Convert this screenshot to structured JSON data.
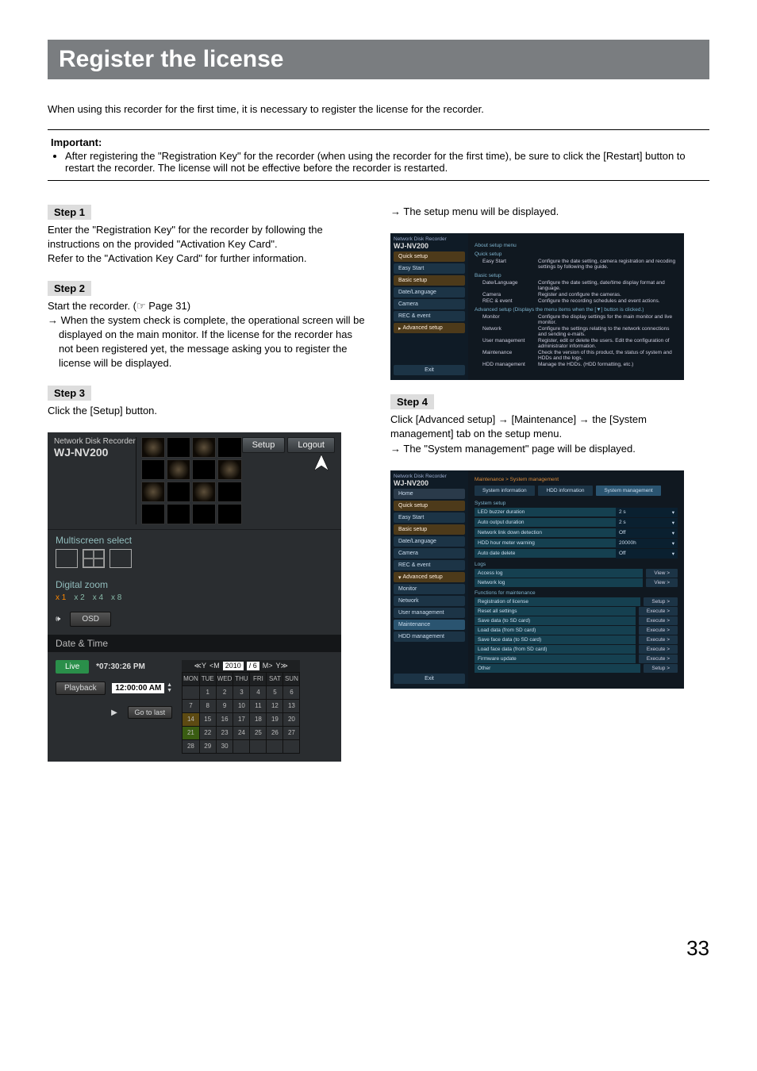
{
  "page": {
    "title": "Register the license",
    "intro": "When using this recorder for the first time, it is necessary to register the license for the recorder.",
    "important_hdr": "Important:",
    "important_bullet": "After registering the \"Registration Key\" for the recorder (when using the recorder for the first time), be sure to click the [Restart] button to restart the recorder. The license will not be effective before the recorder is restarted.",
    "page_number": "33"
  },
  "steps": {
    "s1": {
      "label": "Step 1",
      "body1": "Enter the \"Registration Key\" for the recorder by following the instructions on the provided \"Activation Key Card\".",
      "body2": "Refer to the \"Activation Key Card\" for further information."
    },
    "s2": {
      "label": "Step 2",
      "body1": "Start the recorder. (☞ Page 31)",
      "arrow": "→ When the system check is complete, the operational screen will be displayed on the main monitor. If the license for the recorder has not been registered yet, the message asking you to register the license will be displayed."
    },
    "s3": {
      "label": "Step 3",
      "body1": "Click the [Setup] button.",
      "top_arrow": "→ The setup menu will be displayed."
    },
    "s4": {
      "label": "Step 4",
      "body1": "Click [Advanced setup] → [Maintenance] → the [System management] tab on the setup menu.",
      "arrow": "→ The \"System management\" page will be displayed."
    }
  },
  "shot1": {
    "model_lbl": "Network Disk Recorder",
    "model": "WJ-NV200",
    "btn_setup": "Setup",
    "btn_logout": "Logout",
    "multiscreen": "Multiscreen select",
    "digital_zoom": "Digital zoom",
    "zooms": [
      "x 1",
      "x 2",
      "x 4",
      "x 8"
    ],
    "osd": "OSD",
    "date_time": "Date & Time",
    "live": "Live",
    "live_time": "*07:30:26 PM",
    "playback": "Playback",
    "playback_time": "12:00:00 AM",
    "go_to_last": "Go to last",
    "cal_year": "2010",
    "cal_month_day": "/  6",
    "days": [
      "MON",
      "TUE",
      "WED",
      "THU",
      "FRI",
      "SAT",
      "SUN"
    ],
    "cal": [
      [
        "",
        "1",
        "2",
        "3",
        "4",
        "5",
        "6"
      ],
      [
        "7",
        "8",
        "9",
        "10",
        "11",
        "12",
        "13"
      ],
      [
        "14",
        "15",
        "16",
        "17",
        "18",
        "19",
        "20"
      ],
      [
        "21",
        "22",
        "23",
        "24",
        "25",
        "26",
        "27"
      ],
      [
        "28",
        "29",
        "30",
        "",
        "",
        "",
        ""
      ]
    ]
  },
  "shot2": {
    "model_lbl": "Network Disk Recorder",
    "model": "WJ-NV200",
    "side": {
      "quick_setup": "Quick setup",
      "easy_start": "Easy Start",
      "basic_setup": "Basic setup",
      "date_language": "Date/Language",
      "camera": "Camera",
      "rec_event": "REC & event",
      "advanced_setup": "Advanced setup",
      "exit": "Exit"
    },
    "main": {
      "about": "About setup menu",
      "quick_setup": "Quick setup",
      "easy_start": "Easy Start",
      "easy_start_desc": "Configure the date setting, camera registration and recoding settings by following the guide.",
      "basic_setup": "Basic setup",
      "date_lang": "Date/Language",
      "date_lang_desc": "Configure the date setting, date/time display format and language.",
      "camera": "Camera",
      "camera_desc": "Register and configure the cameras.",
      "rec_event": "REC & event",
      "rec_event_desc": "Configure the recording schedules and event actions.",
      "adv": "Advanced setup (Displays the menu items when the [▼] button is clicked.)",
      "monitor": "Monitor",
      "monitor_desc": "Configure the display settings for the main monitor and live monitor.",
      "network": "Network",
      "network_desc": "Configure the settings relating to the network connections and sending e-mails.",
      "user_mgmt": "User management",
      "user_mgmt_desc": "Register, edit or delete the users. Edit the configuration of administrator information.",
      "maint": "Maintenance",
      "maint_desc": "Check the version of this product, the status of system and HDDs and the logs.",
      "hdd": "HDD management",
      "hdd_desc": "Manage the HDDs. (HDD formatting, etc.)"
    }
  },
  "shot3": {
    "model_lbl": "Network Disk Recorder",
    "model": "WJ-NV200",
    "breadcrumb": "Maintenance > System management",
    "tabs": {
      "sysinfo": "System information",
      "hddinfo": "HDD information",
      "sysmgmt": "System management"
    },
    "side": {
      "home": "Home",
      "quick_setup": "Quick setup",
      "easy_start": "Easy Start",
      "basic_setup": "Basic setup",
      "date_language": "Date/Language",
      "camera": "Camera",
      "rec_event": "REC & event",
      "advanced_setup": "Advanced setup",
      "monitor": "Monitor",
      "network": "Network",
      "user_mgmt": "User management",
      "maintenance": "Maintenance",
      "hdd_mgmt": "HDD management",
      "exit": "Exit"
    },
    "groups": {
      "system": {
        "title": "System setup",
        "rows": [
          {
            "k": "LED buzzer duration",
            "v": "2 s"
          },
          {
            "k": "Auto output duration",
            "v": "2 s"
          },
          {
            "k": "Network link down detection",
            "v": "Off"
          },
          {
            "k": "HDD hour meter warning",
            "v": "20000h"
          },
          {
            "k": "Auto date delete",
            "v": "Off"
          }
        ]
      },
      "logs": {
        "title": "Logs",
        "rows": [
          {
            "k": "Access log",
            "btn": "View >"
          },
          {
            "k": "Network log",
            "btn": "View >"
          }
        ]
      },
      "funcs": {
        "title": "Functions for maintenance",
        "rows": [
          {
            "k": "Registration of license",
            "btn": "Setup >"
          },
          {
            "k": "Reset all settings",
            "btn": "Execute >"
          },
          {
            "k": "Save data (to SD card)",
            "btn": "Execute >"
          },
          {
            "k": "Load data (from SD card)",
            "btn": "Execute >"
          },
          {
            "k": "Save face data (to SD card)",
            "btn": "Execute >"
          },
          {
            "k": "Load face data (from SD card)",
            "btn": "Execute >"
          },
          {
            "k": "Firmware update",
            "btn": "Execute >"
          },
          {
            "k": "Other",
            "btn": "Setup >"
          }
        ]
      }
    }
  }
}
